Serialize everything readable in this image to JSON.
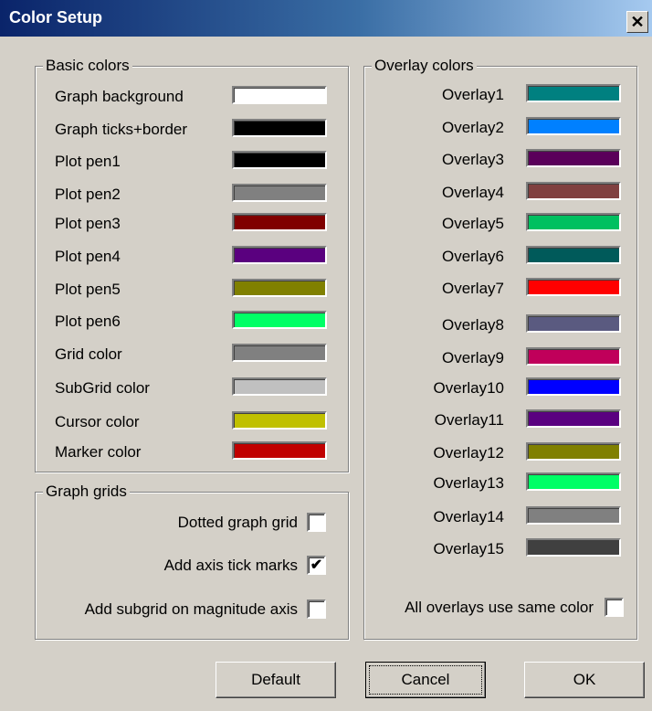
{
  "dialog": {
    "title": "Color Setup",
    "close_glyph": "✕"
  },
  "basic": {
    "legend": "Basic colors",
    "items": [
      {
        "label": "Graph background",
        "color": "#ffffff"
      },
      {
        "label": "Graph ticks+border",
        "color": "#000000"
      },
      {
        "label": "Plot pen1",
        "color": "#000000"
      },
      {
        "label": "Plot pen2",
        "color": "#808080"
      },
      {
        "label": "Plot pen3",
        "color": "#800000"
      },
      {
        "label": "Plot pen4",
        "color": "#5a007f"
      },
      {
        "label": "Plot pen5",
        "color": "#808000"
      },
      {
        "label": "Plot pen6",
        "color": "#00ff66"
      },
      {
        "label": "Grid color",
        "color": "#808080"
      },
      {
        "label": "SubGrid color",
        "color": "#c0c0c0"
      },
      {
        "label": "Cursor color",
        "color": "#c0c000"
      },
      {
        "label": "Marker color",
        "color": "#c00000"
      }
    ]
  },
  "grids": {
    "legend": "Graph grids",
    "options": [
      {
        "label": "Dotted graph grid",
        "checked": false
      },
      {
        "label": "Add axis tick marks",
        "checked": true
      },
      {
        "label": "Add subgrid on magnitude axis",
        "checked": false
      }
    ]
  },
  "overlay": {
    "legend": "Overlay colors",
    "items": [
      {
        "label": "Overlay1",
        "color": "#008080"
      },
      {
        "label": "Overlay2",
        "color": "#0080ff"
      },
      {
        "label": "Overlay3",
        "color": "#5a005a"
      },
      {
        "label": "Overlay4",
        "color": "#804040"
      },
      {
        "label": "Overlay5",
        "color": "#00c060"
      },
      {
        "label": "Overlay6",
        "color": "#005a5a"
      },
      {
        "label": "Overlay7",
        "color": "#ff0000"
      },
      {
        "label": "Overlay8",
        "color": "#5a5a80"
      },
      {
        "label": "Overlay9",
        "color": "#c0005a"
      },
      {
        "label": "Overlay10",
        "color": "#0000ff"
      },
      {
        "label": "Overlay11",
        "color": "#5a0080"
      },
      {
        "label": "Overlay12",
        "color": "#808000"
      },
      {
        "label": "Overlay13",
        "color": "#00ff66"
      },
      {
        "label": "Overlay14",
        "color": "#808080"
      },
      {
        "label": "Overlay15",
        "color": "#404040"
      }
    ],
    "same_color": {
      "label": "All overlays use same color",
      "checked": false
    }
  },
  "buttons": {
    "default": "Default",
    "cancel": "Cancel",
    "ok": "OK"
  },
  "check_glyph": "✔"
}
